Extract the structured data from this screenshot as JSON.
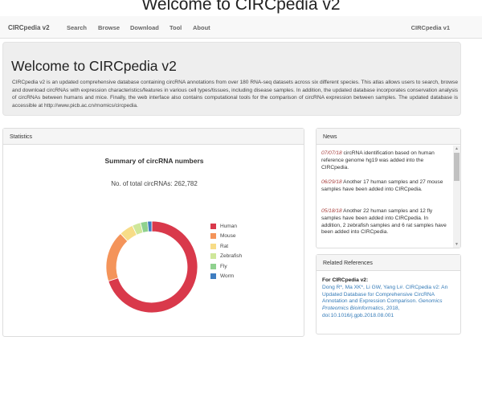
{
  "page": {
    "heading": "Welcome to CIRCpedia v2"
  },
  "navbar": {
    "brand": "CIRCpedia v2",
    "items": [
      {
        "label": "Search"
      },
      {
        "label": "Browse"
      },
      {
        "label": "Download"
      },
      {
        "label": "Tool"
      },
      {
        "label": "About"
      }
    ],
    "right_label": "CIRCpedia v1"
  },
  "jumbotron": {
    "title": "Welcome to CIRCpedia v2",
    "description": "CIRCpedia v2 is an updated comprehensive database containing circRNA annotations from over 180 RNA-seq datasets across six different species. This atlas allows users to search, browse and download circRNAs with expression characteristics/features in various cell types/tissues, including disease samples. In addition, the updated database incorporates conservation analysis of circRNAs between humans and mice. Finally, the web interface also contains computational tools for the comparison of circRNA expression between samples. The updated database is accessible at http://www.picb.ac.cn/rnomics/circpedia."
  },
  "statistics": {
    "heading": "Statistics",
    "chart_title": "Summary of circRNA numbers",
    "total_label": "No. of total circRNAs: 262,782"
  },
  "chart_data": {
    "type": "pie",
    "title": "Summary of circRNA numbers",
    "categories": [
      "Human",
      "Mouse",
      "Rat",
      "Zebrafish",
      "Fly",
      "Worm"
    ],
    "values": [
      183943,
      47301,
      13139,
      7884,
      6570,
      3945
    ],
    "colors": [
      "#d9394b",
      "#f4945a",
      "#f7dc87",
      "#cfe79a",
      "#8fd18e",
      "#3f7dc0"
    ],
    "donut": true,
    "legend_position": "right"
  },
  "news": {
    "heading": "News",
    "items": [
      {
        "date": "07/07/18",
        "text": " circRNA identification based on human reference genome hg19 was added into the CIRCpedia."
      },
      {
        "date": "06/29/18",
        "text": " Another 17 human samples and 27 mouse samples have been added into CIRCpedia."
      },
      {
        "date": "05/18/18",
        "text": " Another 22 human samples and 12 fly samples have been added into CIRCpedia. In addition, 2 zebrafish samples and 6 rat samples have been added into CIRCpedia."
      }
    ]
  },
  "references": {
    "heading": "Related References",
    "label": "For CIRCpedia v2:",
    "authors": "Dong R*, Ma XK*, Li GW, Yang L#. CIRCpedia v2: An Updated Database for Comprehensive CircRNA Annotation and Expression Comparison. ",
    "journal": "Genomics Proteomics Bioinformatics",
    "tail": ", 2018, doi:10.1016/j.gpb.2018.08.001"
  }
}
